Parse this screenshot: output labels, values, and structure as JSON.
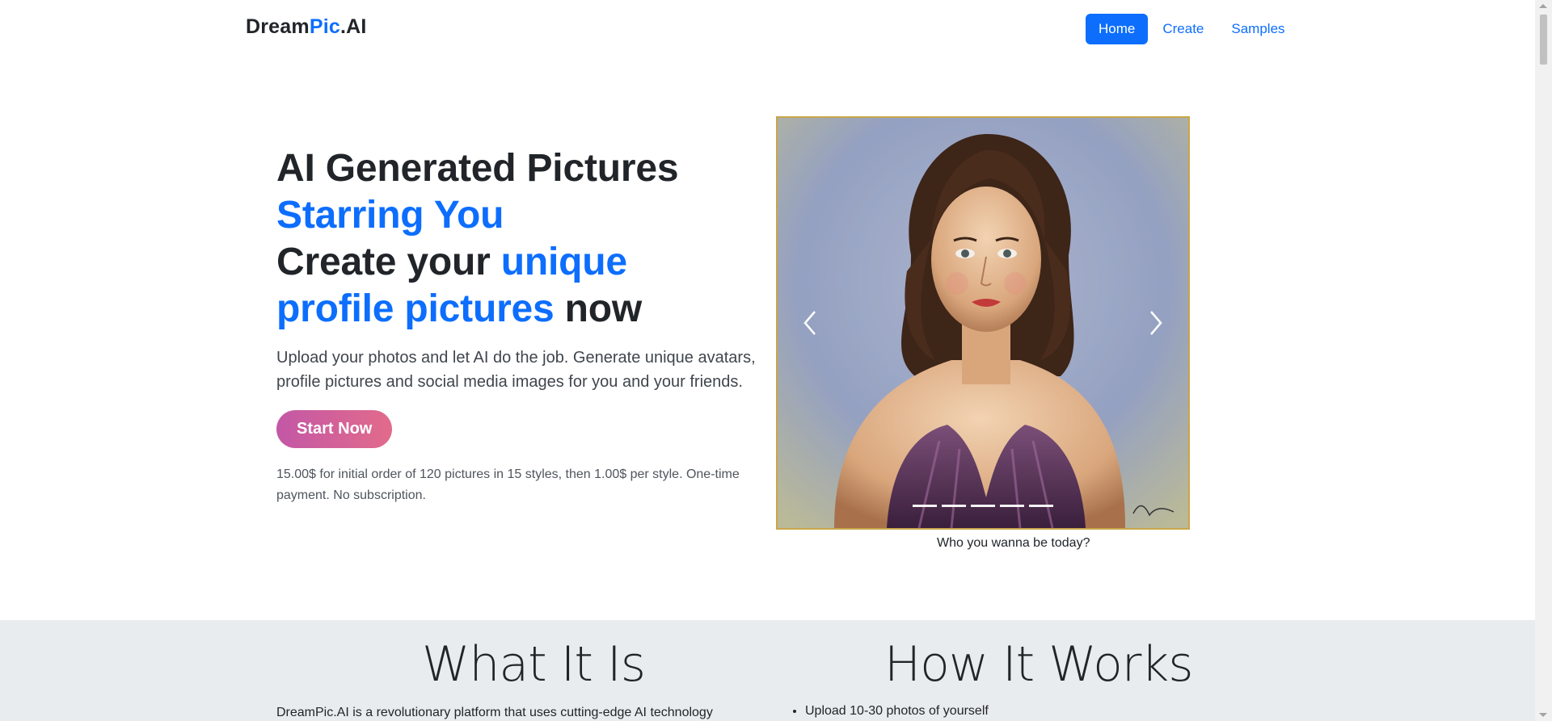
{
  "nav": {
    "brand_prefix": "Dream",
    "brand_accent": "Pic",
    "brand_suffix": ".AI",
    "links": [
      {
        "label": "Home",
        "active": true
      },
      {
        "label": "Create",
        "active": false
      },
      {
        "label": "Samples",
        "active": false
      }
    ]
  },
  "hero": {
    "title_line1": "AI Generated Pictures",
    "title_line2": "Starring You",
    "title_line3_a": "Create your ",
    "title_line3_b": "unique",
    "title_line4_a": "profile pictures",
    "title_line4_b": " now",
    "lead": "Upload your photos and let AI do the job. Generate unique avatars, profile pictures and social media images for you and your friends.",
    "cta_label": "Start Now",
    "price_note": "15.00$ for initial order of 120 pictures in 15 styles, then 1.00$ per style. One-time payment. No subscription."
  },
  "carousel": {
    "image_icon": "portrait-painting",
    "prev_icon": "chevron-left-icon",
    "next_icon": "chevron-right-icon",
    "slide_count": 5,
    "active_slide": 1,
    "caption": "Who you wanna be today?"
  },
  "info": {
    "what_title": "What It Is",
    "what_body": "DreamPic.AI is a revolutionary platform that uses cutting-edge AI technology",
    "how_title": "How It Works",
    "how_steps": [
      "Upload 10-30 photos of yourself"
    ]
  },
  "colors": {
    "accent": "#0d6efd",
    "cta_gradient_start": "#c357a6",
    "cta_gradient_end": "#e26b8b",
    "section_bg": "#e9ecef"
  }
}
